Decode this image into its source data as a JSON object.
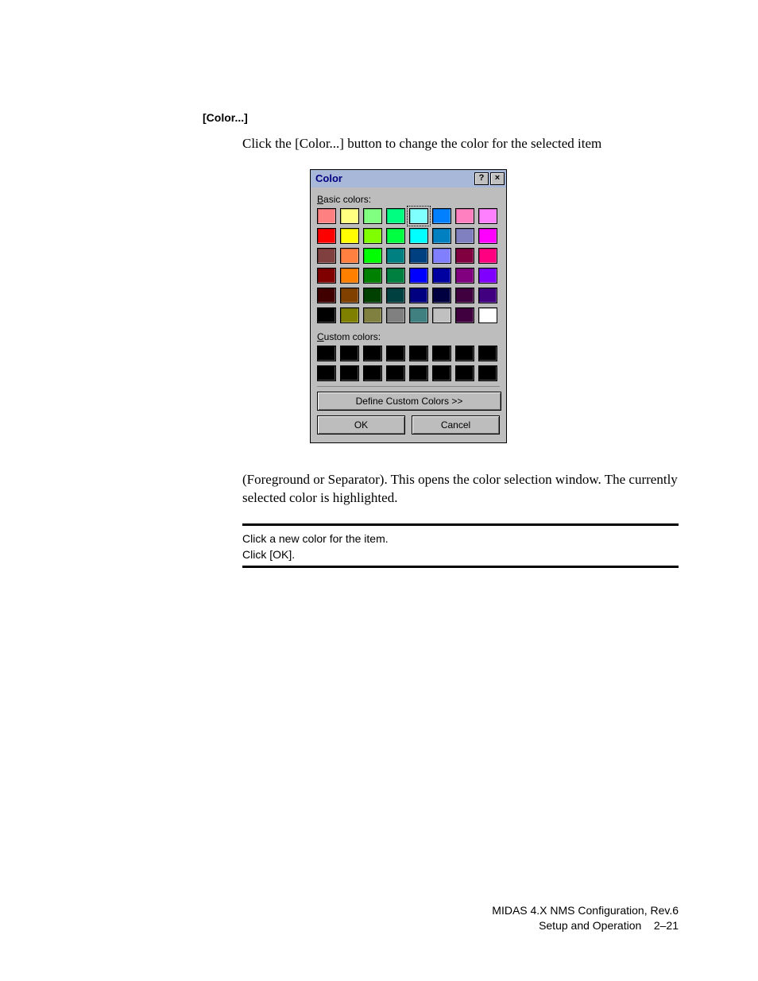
{
  "section_heading": "[Color...]",
  "intro_text": "Click the [Color...] button to change the color for the selected item",
  "dialog": {
    "title": "Color",
    "help_glyph": "?",
    "close_glyph": "×",
    "basic_label_prefix": "B",
    "basic_label_rest": "asic colors:",
    "custom_label_prefix": "C",
    "custom_label_rest": "ustom colors:",
    "define_prefix": "D",
    "define_rest": "efine Custom Colors >>",
    "ok": "OK",
    "cancel": "Cancel",
    "basic_colors": [
      "#ff8080",
      "#ffff80",
      "#80ff80",
      "#00ff80",
      "#80ffff",
      "#0080ff",
      "#ff80c0",
      "#ff80ff",
      "#ff0000",
      "#ffff00",
      "#80ff00",
      "#00ff40",
      "#00ffff",
      "#0080c0",
      "#8080c0",
      "#ff00ff",
      "#804040",
      "#ff8040",
      "#00ff00",
      "#008080",
      "#004080",
      "#8080ff",
      "#800040",
      "#ff0080",
      "#800000",
      "#ff8000",
      "#008000",
      "#008040",
      "#0000ff",
      "#0000a0",
      "#800080",
      "#8000ff",
      "#400000",
      "#804000",
      "#004000",
      "#004040",
      "#000080",
      "#000040",
      "#400040",
      "#400080",
      "#000000",
      "#808000",
      "#808040",
      "#808080",
      "#408080",
      "#c0c0c0",
      "#400040",
      "#ffffff"
    ],
    "selected_index": 4,
    "custom_colors": [
      "#000000",
      "#000000",
      "#000000",
      "#000000",
      "#000000",
      "#000000",
      "#000000",
      "#000000",
      "#000000",
      "#000000",
      "#000000",
      "#000000",
      "#000000",
      "#000000",
      "#000000",
      "#000000"
    ]
  },
  "after_text": "(Foreground or Separator). This opens the color selection window. The currently selected color is highlighted.",
  "steps": {
    "line1": "Click a new color for the item.",
    "line2": "Click [OK]."
  },
  "footer": {
    "line1": "MIDAS 4.X NMS Configuration, Rev.6",
    "line2_left": "Setup and Operation",
    "line2_right": "2–21"
  }
}
